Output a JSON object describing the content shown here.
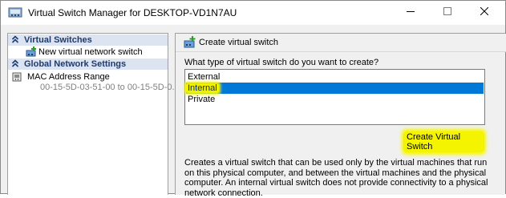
{
  "window": {
    "title": "Virtual Switch Manager for DESKTOP-VD1N7AU",
    "controls": {
      "minimize": "minimize",
      "maximize": "maximize",
      "close": "close"
    }
  },
  "sidebar": {
    "sections": [
      {
        "label": "Virtual Switches",
        "items": [
          {
            "label": "New virtual network switch",
            "icon": "add-switch-icon"
          }
        ]
      },
      {
        "label": "Global Network Settings",
        "items": [
          {
            "label": "MAC Address Range",
            "sub": "00-15-5D-03-51-00 to 00-15-5D-0...",
            "icon": "network-adapter-icon"
          }
        ]
      }
    ]
  },
  "main": {
    "header": "Create virtual switch",
    "question": "What type of virtual switch do you want to create?",
    "options": [
      "External",
      "Internal",
      "Private"
    ],
    "selected": "Internal",
    "button_label": "Create Virtual Switch",
    "description": "Creates a virtual switch that can be used only by the virtual machines that run on this physical computer, and between the virtual machines and the physical computer. An internal virtual switch does not provide connectivity to a physical network connection."
  },
  "colors": {
    "selection": "#0078d7",
    "highlight": "#f0f000",
    "section_header_bg": "#dbe4f0",
    "section_header_text": "#1e3a6e"
  }
}
